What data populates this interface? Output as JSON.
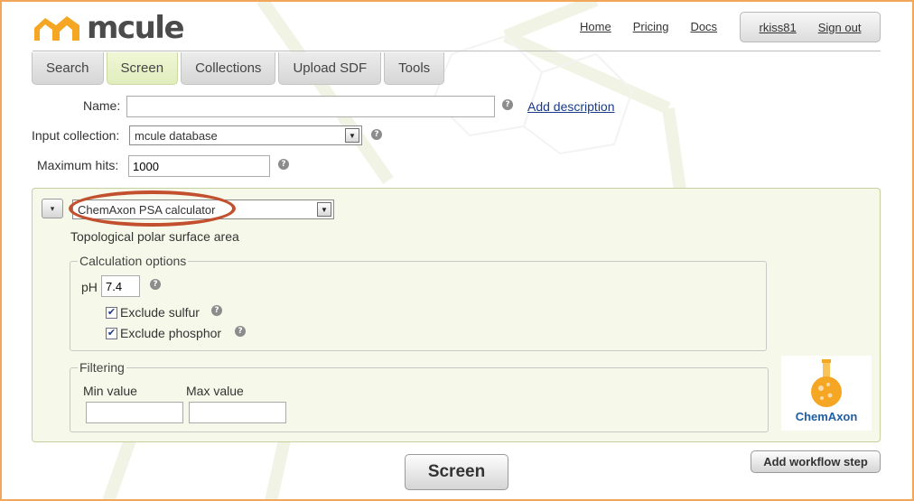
{
  "logo": {
    "text": "mcule"
  },
  "nav": {
    "home": "Home",
    "pricing": "Pricing",
    "docs": "Docs"
  },
  "user": {
    "name": "rkiss81",
    "signout": "Sign out"
  },
  "tabs": [
    "Search",
    "Screen",
    "Collections",
    "Upload SDF",
    "Tools"
  ],
  "active_tab": "Screen",
  "form": {
    "name_label": "Name:",
    "name_value": "",
    "add_description": "Add description",
    "input_collection_label": "Input collection:",
    "input_collection_value": "mcule database",
    "max_hits_label": "Maximum hits:",
    "max_hits_value": "1000"
  },
  "step": {
    "toggle": "▾",
    "calculator": "ChemAxon PSA calculator",
    "description": "Topological polar surface area",
    "calc_options_legend": "Calculation options",
    "ph_label": "pH",
    "ph_value": "7.4",
    "exclude_sulfur": "Exclude sulfur",
    "exclude_sulfur_checked": true,
    "exclude_phosphor": "Exclude phosphor",
    "exclude_phosphor_checked": true,
    "filtering_legend": "Filtering",
    "min_label": "Min value",
    "max_label": "Max value",
    "min_value": "",
    "max_value": "",
    "vendor_logo_text": "ChemAxon"
  },
  "help_glyph": "?",
  "check_glyph": "✔",
  "buttons": {
    "screen": "Screen",
    "add_step": "Add workflow step"
  },
  "colors": {
    "accent_green": "#f6f9ea",
    "highlight_ring": "#c2502e",
    "logo_orange": "#f5a623",
    "frame": "#f2a65a"
  }
}
